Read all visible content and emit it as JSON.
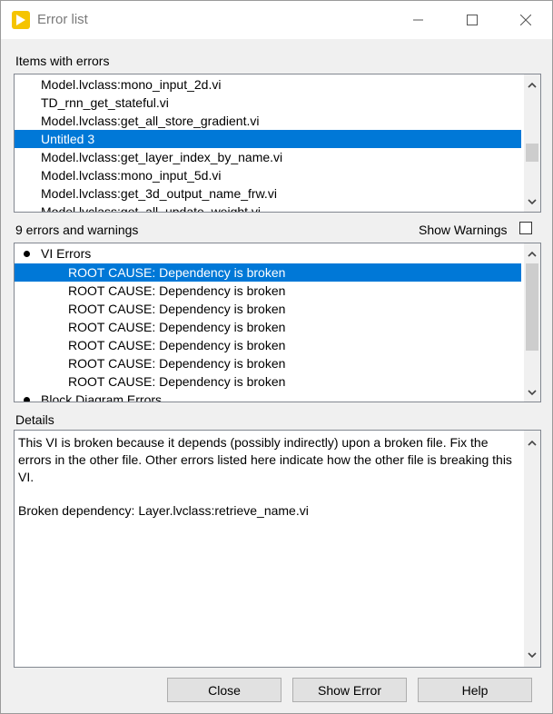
{
  "window": {
    "title": "Error list"
  },
  "items_section": {
    "label": "Items with errors",
    "items": [
      {
        "label": "Model.lvclass:mono_input_2d.vi",
        "selected": false
      },
      {
        "label": "TD_rnn_get_stateful.vi",
        "selected": false
      },
      {
        "label": "Model.lvclass:get_all_store_gradient.vi",
        "selected": false
      },
      {
        "label": "Untitled 3",
        "selected": true
      },
      {
        "label": "Model.lvclass:get_layer_index_by_name.vi",
        "selected": false
      },
      {
        "label": "Model.lvclass:mono_input_5d.vi",
        "selected": false
      },
      {
        "label": "Model.lvclass:get_3d_output_name_frw.vi",
        "selected": false
      },
      {
        "label": "Model.lvclass:get_all_update_weight.vi",
        "selected": false
      }
    ]
  },
  "errors_section": {
    "count_label": "9 errors and warnings",
    "show_warnings_label": "Show Warnings",
    "show_warnings_checked": false,
    "groups": [
      {
        "label": "VI Errors",
        "entries": [
          {
            "label": "ROOT CAUSE: Dependency is broken",
            "selected": true
          },
          {
            "label": "ROOT CAUSE: Dependency is broken",
            "selected": false
          },
          {
            "label": "ROOT CAUSE: Dependency is broken",
            "selected": false
          },
          {
            "label": "ROOT CAUSE: Dependency is broken",
            "selected": false
          },
          {
            "label": "ROOT CAUSE: Dependency is broken",
            "selected": false
          },
          {
            "label": "ROOT CAUSE: Dependency is broken",
            "selected": false
          },
          {
            "label": "ROOT CAUSE: Dependency is broken",
            "selected": false
          }
        ]
      },
      {
        "label": "Block Diagram Errors",
        "entries": []
      }
    ]
  },
  "details_section": {
    "label": "Details",
    "paragraph1": "This VI is broken because it depends (possibly indirectly) upon a broken file. Fix the errors in the other file. Other errors listed here indicate how the other file is breaking this VI.",
    "paragraph2": "Broken dependency: Layer.lvclass:retrieve_name.vi"
  },
  "buttons": {
    "close": "Close",
    "show_error": "Show Error",
    "help": "Help"
  },
  "colors": {
    "selection": "#0078d7",
    "app_icon": "#f5c400"
  }
}
